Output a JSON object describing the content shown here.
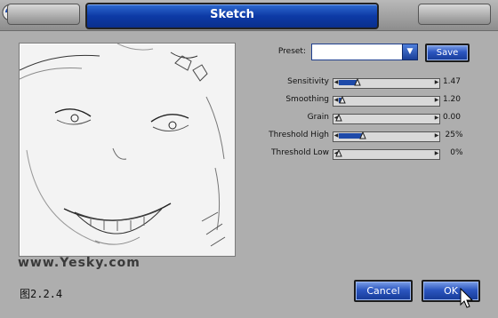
{
  "window": {
    "title": "Sketch"
  },
  "watermark": "www.Yesky.com",
  "caption": "图2.2.4",
  "preset": {
    "label": "Preset:",
    "value": "",
    "save_label": "Save"
  },
  "sliders": [
    {
      "label": "Sensitivity",
      "value": "1.47",
      "unit": "",
      "level": 0.2
    },
    {
      "label": "Smoothing",
      "value": "1.20",
      "unit": "",
      "level": 0.04
    },
    {
      "label": "Grain",
      "value": "0.00",
      "unit": "",
      "level": 0.0
    },
    {
      "label": "Threshold High",
      "value": "25",
      "unit": "%",
      "level": 0.25
    },
    {
      "label": "Threshold Low",
      "value": "0",
      "unit": "%",
      "level": 0.0
    }
  ],
  "buttons": {
    "cancel": "Cancel",
    "ok": "OK"
  },
  "colors": {
    "accent": "#1e4aa9",
    "background": "#aeaeae"
  }
}
